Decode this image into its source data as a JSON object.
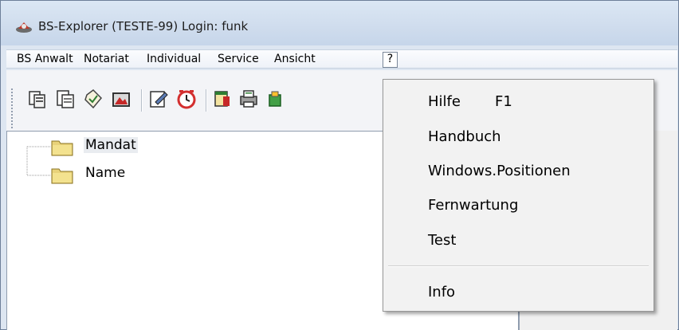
{
  "window": {
    "title": "BS-Explorer (TESTE-99) Login: funk"
  },
  "menubar": {
    "items": [
      "BS Anwalt",
      "Notariat",
      "Individual",
      "Service",
      "Ansicht",
      "?"
    ],
    "active": "?"
  },
  "toolbar": {
    "buttons": [
      "copy-documents-icon",
      "document-list-icon",
      "checklist-icon",
      "photo-edit-icon",
      "edit-note-icon",
      "alarm-clock-icon",
      "calendar-icon",
      "printer-icon",
      "green-box-icon"
    ]
  },
  "tree": {
    "items": [
      {
        "label": "Mandat",
        "selected": true
      },
      {
        "label": "Name",
        "selected": false
      }
    ]
  },
  "dropdown": {
    "items": [
      {
        "label": "Hilfe",
        "shortcut": "F1"
      },
      {
        "label": "Handbuch"
      },
      {
        "label": "Windows.Positionen"
      },
      {
        "label": "Fernwartung"
      },
      {
        "label": "Test"
      },
      {
        "label": "Info"
      }
    ]
  }
}
